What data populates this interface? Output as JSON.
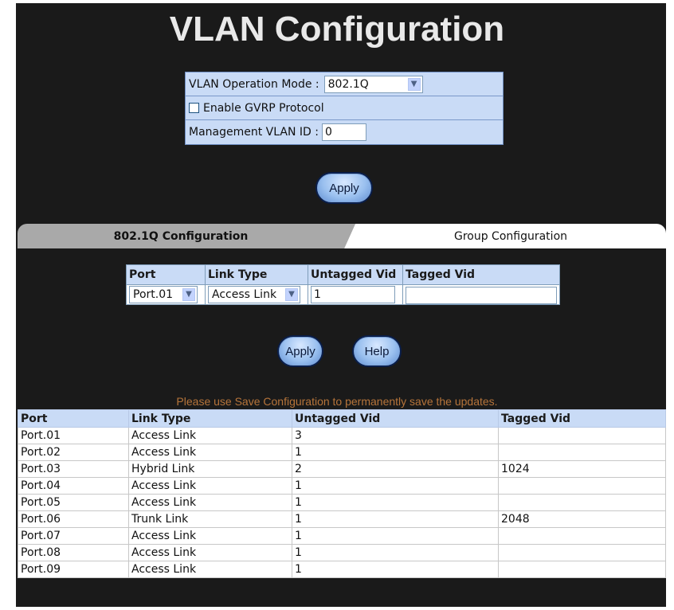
{
  "title": "VLAN Configuration",
  "mode": {
    "operation_label": "VLAN Operation Mode :",
    "operation_value": "802.1Q",
    "gvrp_label": "Enable GVRP Protocol",
    "mgmt_label": "Management VLAN ID :",
    "mgmt_value": "0"
  },
  "buttons": {
    "apply": "Apply",
    "help": "Help"
  },
  "tabs": {
    "active": "802.1Q Configuration",
    "inactive": "Group Configuration"
  },
  "edit": {
    "headers": [
      "Port",
      "Link Type",
      "Untagged Vid",
      "Tagged Vid"
    ],
    "port_value": "Port.01",
    "link_value": "Access Link",
    "untagged_value": "1",
    "tagged_value": ""
  },
  "notice": "Please use Save Configuration to permanently save the updates.",
  "list": {
    "headers": [
      "Port",
      "Link Type",
      "Untagged Vid",
      "Tagged Vid"
    ],
    "rows": [
      [
        "Port.01",
        "Access Link",
        "3",
        ""
      ],
      [
        "Port.02",
        "Access Link",
        "1",
        ""
      ],
      [
        "Port.03",
        "Hybrid Link",
        "2",
        "1024"
      ],
      [
        "Port.04",
        "Access Link",
        "1",
        ""
      ],
      [
        "Port.05",
        "Access Link",
        "1",
        ""
      ],
      [
        "Port.06",
        "Trunk Link",
        "1",
        "2048"
      ],
      [
        "Port.07",
        "Access Link",
        "1",
        ""
      ],
      [
        "Port.08",
        "Access Link",
        "1",
        ""
      ],
      [
        "Port.09",
        "Access Link",
        "1",
        ""
      ]
    ]
  }
}
